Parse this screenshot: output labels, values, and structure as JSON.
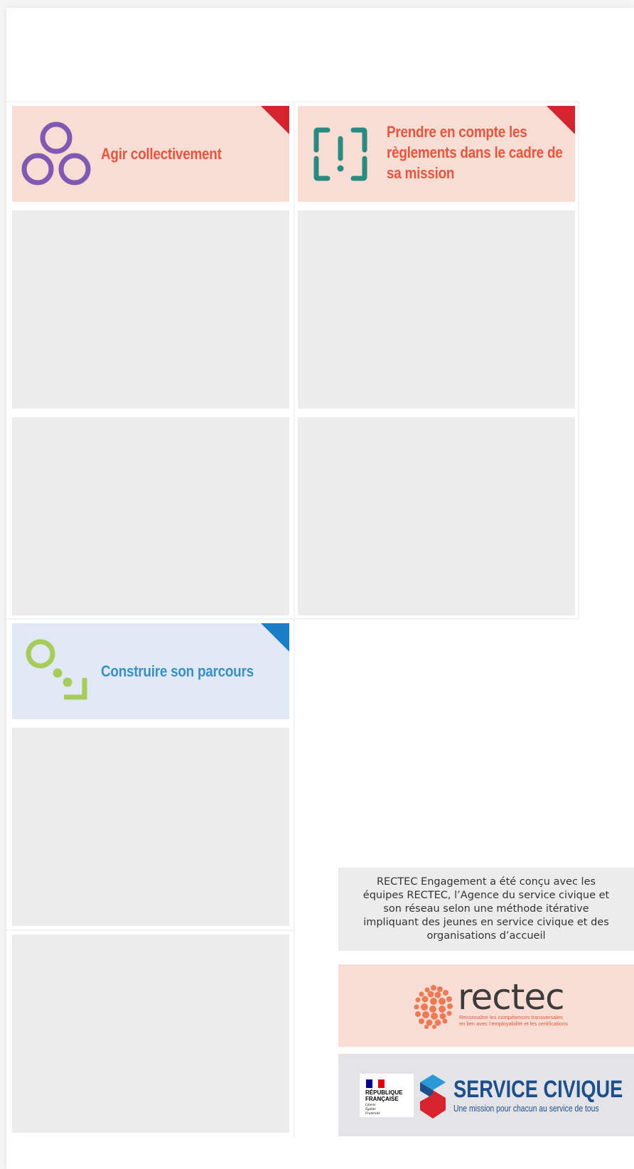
{
  "cards": [
    {
      "title": "Agir collectivement",
      "variant": "red",
      "icon": "three-circles-icon"
    },
    {
      "title": "Prendre en compte les règlements dans le cadre de sa mission",
      "variant": "red",
      "icon": "exclamation-bracket-icon"
    },
    {
      "title": "Construire son parcours",
      "variant": "blue",
      "icon": "path-dots-icon"
    }
  ],
  "footer": {
    "info_text": "RECTEC Engagement a été conçu avec les équipes RECTEC, l’Agence du service civique et son réseau selon une méthode itérative impliquant des jeunes en service civique et des organisations d’accueil",
    "rectec": {
      "name": "rectec",
      "tagline_line1": "Reconnaître les compétences transversales",
      "tagline_line2": "en lien avec l’employabilité et les certifications"
    },
    "republique": {
      "line1": "RÉPUBLIQUE",
      "line2": "FRANÇAISE",
      "motto1": "Liberté",
      "motto2": "Égalité",
      "motto3": "Fraternité"
    },
    "service_civique": {
      "title": "SERVICE CIVIQUE",
      "subtitle": "Une mission pour chacun au service de tous"
    }
  },
  "colors": {
    "card_red_bg": "#f8ddd4",
    "card_blue_bg": "#e1e9f6",
    "accent_red": "#d6242f",
    "accent_blue": "#1a7dc8",
    "title_red": "#e8553f",
    "title_blue": "#3a8fc4",
    "purple_icon": "#8059b2",
    "teal_icon": "#2a8a80",
    "green_icon": "#a6cc5a",
    "service_civique_blue": "#1d4f8a"
  }
}
